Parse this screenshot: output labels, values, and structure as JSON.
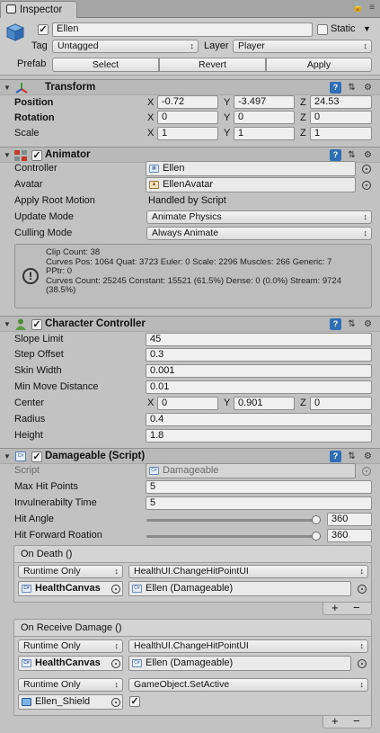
{
  "tab": {
    "label": "Inspector"
  },
  "header": {
    "name": "Ellen",
    "static_label": "Static",
    "tag_label": "Tag",
    "tag_value": "Untagged",
    "layer_label": "Layer",
    "layer_value": "Player",
    "prefab_label": "Prefab",
    "select_label": "Select",
    "revert_label": "Revert",
    "apply_label": "Apply"
  },
  "transform": {
    "title": "Transform",
    "position_label": "Position",
    "rotation_label": "Rotation",
    "scale_label": "Scale",
    "position": {
      "x": "-0.72",
      "y": "-3.497",
      "z": "24.53"
    },
    "rotation": {
      "x": "0",
      "y": "0",
      "z": "0"
    },
    "scale": {
      "x": "1",
      "y": "1",
      "z": "1"
    },
    "axis_x": "X",
    "axis_y": "Y",
    "axis_z": "Z"
  },
  "animator": {
    "title": "Animator",
    "controller_label": "Controller",
    "controller_value": "Ellen",
    "avatar_label": "Avatar",
    "avatar_value": "EllenAvatar",
    "root_motion_label": "Apply Root Motion",
    "root_motion_value": "Handled by Script",
    "update_mode_label": "Update Mode",
    "update_mode_value": "Animate Physics",
    "culling_mode_label": "Culling Mode",
    "culling_mode_value": "Always Animate",
    "info": "Clip Count: 38\nCurves Pos: 1064 Quat: 3723 Euler: 0 Scale: 2296 Muscles: 266 Generic: 7\nPPtr: 0\nCurves Count: 25245 Constant: 15521 (61.5%) Dense: 0 (0.0%) Stream: 9724\n(38.5%)"
  },
  "character_controller": {
    "title": "Character Controller",
    "slope_limit_label": "Slope Limit",
    "slope_limit": "45",
    "step_offset_label": "Step Offset",
    "step_offset": "0.3",
    "skin_width_label": "Skin Width",
    "skin_width": "0.001",
    "min_move_label": "Min Move Distance",
    "min_move": "0.01",
    "center_label": "Center",
    "center": {
      "x": "0",
      "y": "0.901",
      "z": "0"
    },
    "radius_label": "Radius",
    "radius": "0.4",
    "height_label": "Height",
    "height": "1.8"
  },
  "damageable": {
    "title": "Damageable (Script)",
    "script_label": "Script",
    "script_value": "Damageable",
    "max_hp_label": "Max Hit Points",
    "max_hp": "5",
    "invuln_label": "Invulnerabilty Time",
    "invuln": "5",
    "hit_angle_label": "Hit Angle",
    "hit_angle": "360",
    "hit_angle_fraction": 1.0,
    "hit_forward_label": "Hit Forward Roation",
    "hit_forward": "360",
    "hit_forward_fraction": 1.0,
    "on_death": {
      "title": "On Death ()",
      "runtime": "Runtime Only",
      "function": "HealthUI.ChangeHitPointUI",
      "object": "HealthCanvas",
      "target": "Ellen (Damageable)"
    },
    "on_receive": {
      "title": "On Receive Damage ()",
      "entry1": {
        "runtime": "Runtime Only",
        "function": "HealthUI.ChangeHitPointUI",
        "object": "HealthCanvas",
        "target": "Ellen (Damageable)"
      },
      "entry2": {
        "runtime": "Runtime Only",
        "function": "GameObject.SetActive",
        "object": "Ellen_Shield"
      }
    },
    "plus": "+",
    "minus": "−"
  },
  "colors": {
    "panel": "#c2c2c2",
    "header": "#cbcbcb",
    "help_icon": "#2f6fb5"
  }
}
